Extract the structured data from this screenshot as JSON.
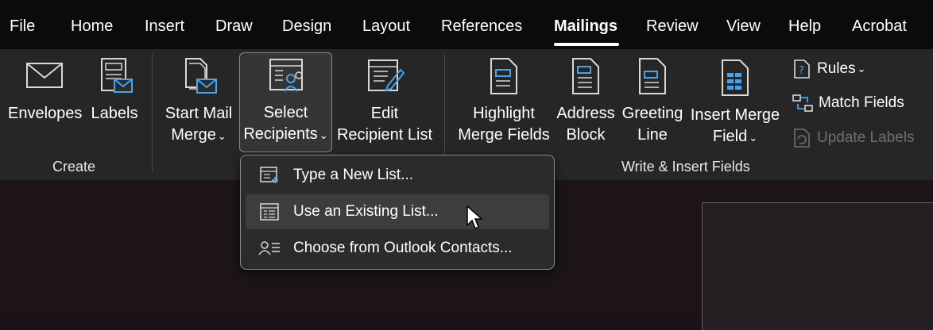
{
  "menu": {
    "tabs": [
      {
        "label": "File"
      },
      {
        "label": "Home"
      },
      {
        "label": "Insert"
      },
      {
        "label": "Draw"
      },
      {
        "label": "Design"
      },
      {
        "label": "Layout"
      },
      {
        "label": "References"
      },
      {
        "label": "Mailings"
      },
      {
        "label": "Review"
      },
      {
        "label": "View"
      },
      {
        "label": "Help"
      },
      {
        "label": "Acrobat"
      }
    ],
    "active": "Mailings"
  },
  "ribbon": {
    "create": {
      "label": "Create",
      "envelopes": "Envelopes",
      "labels": "Labels"
    },
    "start_mail_merge": {
      "start_mail_merge_line1": "Start Mail",
      "start_mail_merge_line2": "Merge",
      "select_recipients_line1": "Select",
      "select_recipients_line2": "Recipients",
      "edit_recipient_list_line1": "Edit",
      "edit_recipient_list_line2": "Recipient List"
    },
    "write_insert": {
      "label": "Write & Insert Fields",
      "highlight_line1": "Highlight",
      "highlight_line2": "Merge Fields",
      "address_line1": "Address",
      "address_line2": "Block",
      "greeting_line1": "Greeting",
      "greeting_line2": "Line",
      "insert_merge_line1": "Insert Merge",
      "insert_merge_line2": "Field",
      "rules": "Rules",
      "match_fields": "Match Fields",
      "update_labels": "Update Labels"
    }
  },
  "dropdown": {
    "items": [
      {
        "label": "Type a New List...",
        "icon": "new-list-icon"
      },
      {
        "label": "Use an Existing List...",
        "icon": "existing-list-icon"
      },
      {
        "label": "Choose from Outlook Contacts...",
        "icon": "outlook-contacts-icon"
      }
    ]
  },
  "colors": {
    "menubar_bg": "#0b0a0c",
    "ribbon_bg": "#262626",
    "doc_bg": "#1c1419",
    "accent_blue": "#4aa3e8"
  }
}
